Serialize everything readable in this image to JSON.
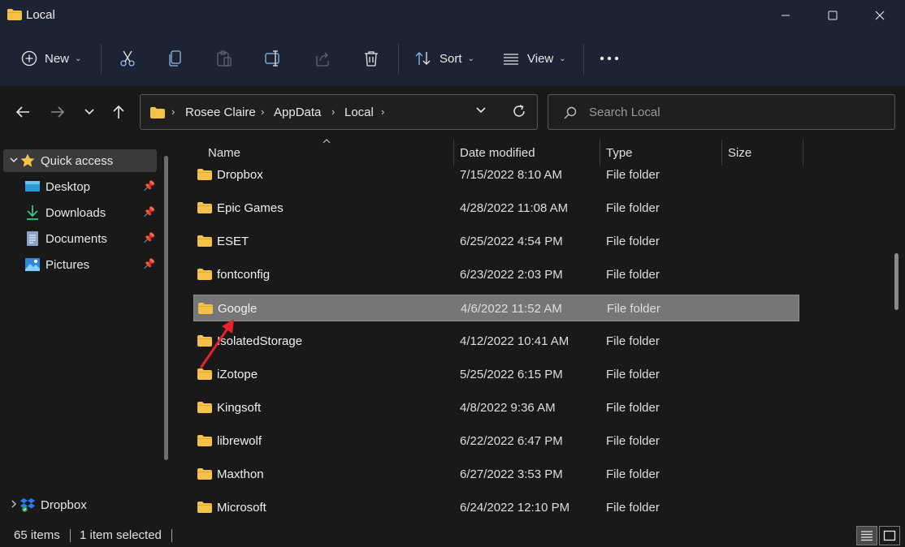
{
  "window": {
    "title": "Local",
    "icons": {
      "folder": "folder-icon",
      "minimize": "minimize-icon",
      "maximize": "maximize-icon",
      "close": "close-icon"
    }
  },
  "toolbar": {
    "new_label": "New",
    "sort_label": "Sort",
    "view_label": "View",
    "icons": [
      "plus-circle-icon",
      "cut-icon",
      "copy-icon",
      "paste-icon",
      "rename-icon",
      "share-icon",
      "delete-icon",
      "sort-icon",
      "view-icon",
      "more-icon"
    ]
  },
  "address": {
    "crumbs": [
      "Rosee Claire",
      "AppData",
      "Local"
    ]
  },
  "search": {
    "placeholder": "Search Local"
  },
  "sidebar": {
    "quick_access": "Quick access",
    "items": [
      {
        "label": "Desktop",
        "icon": "desktop-icon",
        "pinned": true
      },
      {
        "label": "Downloads",
        "icon": "download-icon",
        "pinned": true
      },
      {
        "label": "Documents",
        "icon": "document-icon",
        "pinned": true
      },
      {
        "label": "Pictures",
        "icon": "pictures-icon",
        "pinned": true
      }
    ],
    "dropbox": "Dropbox"
  },
  "columns": {
    "name": "Name",
    "date": "Date modified",
    "type": "Type",
    "size": "Size"
  },
  "files": [
    {
      "name": "Dropbox",
      "date": "7/15/2022 8:10 AM",
      "type": "File folder"
    },
    {
      "name": "Epic Games",
      "date": "4/28/2022 11:08 AM",
      "type": "File folder"
    },
    {
      "name": "ESET",
      "date": "6/25/2022 4:54 PM",
      "type": "File folder"
    },
    {
      "name": "fontconfig",
      "date": "6/23/2022 2:03 PM",
      "type": "File folder"
    },
    {
      "name": "Google",
      "date": "4/6/2022 11:52 AM",
      "type": "File folder",
      "selected": true
    },
    {
      "name": "IsolatedStorage",
      "date": "4/12/2022 10:41 AM",
      "type": "File folder"
    },
    {
      "name": "iZotope",
      "date": "5/25/2022 6:15 PM",
      "type": "File folder"
    },
    {
      "name": "Kingsoft",
      "date": "4/8/2022 9:36 AM",
      "type": "File folder"
    },
    {
      "name": "librewolf",
      "date": "6/22/2022 6:47 PM",
      "type": "File folder"
    },
    {
      "name": "Maxthon",
      "date": "6/27/2022 3:53 PM",
      "type": "File folder"
    },
    {
      "name": "Microsoft",
      "date": "6/24/2022 12:10 PM",
      "type": "File folder"
    }
  ],
  "status": {
    "items_count": "65 items",
    "selected_count": "1 item selected"
  },
  "colors": {
    "folder": "#f4c24a",
    "selection": "#767676",
    "annotation_arrow": "#e8202a"
  }
}
